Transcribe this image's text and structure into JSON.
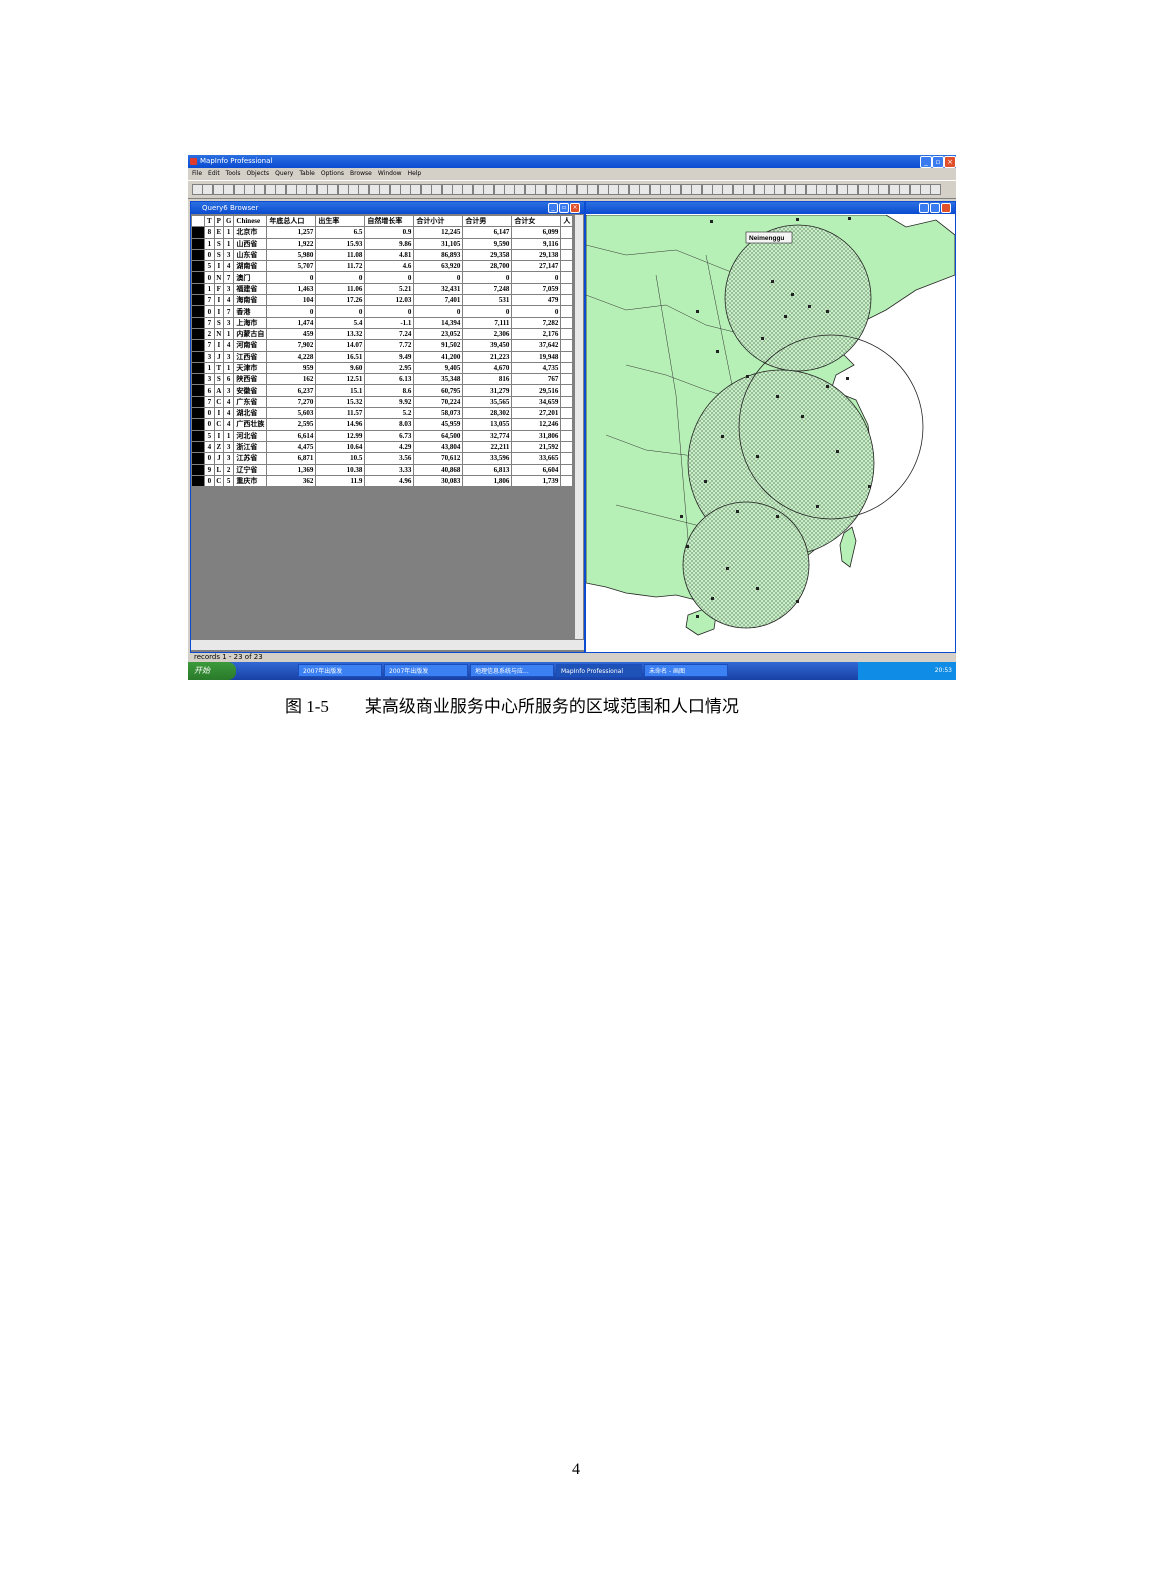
{
  "app": {
    "title": "MapInfo Professional",
    "menu": [
      "File",
      "Edit",
      "Tools",
      "Objects",
      "Query",
      "Table",
      "Options",
      "Browse",
      "Window",
      "Help"
    ]
  },
  "browser": {
    "title": "Query6 Browser",
    "columns": [
      "T",
      "P",
      "G",
      "Chinese",
      "年底总人口",
      "出生率",
      "自然增长率",
      "合计小计",
      "合计男",
      "合计女",
      "人"
    ],
    "rows": [
      [
        "8",
        "E",
        "1",
        "北京市",
        "1,257",
        "6.5",
        "0.9",
        "12,245",
        "6,147",
        "6,099"
      ],
      [
        "1",
        "S",
        "1",
        "山西省",
        "1,922",
        "15.93",
        "9.86",
        "31,105",
        "9,590",
        "9,116"
      ],
      [
        "0",
        "S",
        "3",
        "山东省",
        "5,980",
        "11.08",
        "4.81",
        "86,893",
        "29,358",
        "29,138"
      ],
      [
        "5",
        "I",
        "4",
        "湖南省",
        "5,707",
        "11.72",
        "4.6",
        "63,920",
        "28,700",
        "27,147"
      ],
      [
        "0",
        "N",
        "7",
        "澳门",
        "0",
        "0",
        "0",
        "0",
        "0",
        "0"
      ],
      [
        "1",
        "F",
        "3",
        "福建省",
        "1,463",
        "11.06",
        "5.21",
        "32,431",
        "7,248",
        "7,059"
      ],
      [
        "7",
        "I",
        "4",
        "海南省",
        "104",
        "17.26",
        "12.03",
        "7,401",
        "531",
        "479"
      ],
      [
        "0",
        "I",
        "7",
        "香港",
        "0",
        "0",
        "0",
        "0",
        "0",
        "0"
      ],
      [
        "7",
        "S",
        "3",
        "上海市",
        "1,474",
        "5.4",
        "-1.1",
        "14,394",
        "7,111",
        "7,282"
      ],
      [
        "2",
        "N",
        "1",
        "内蒙古自",
        "459",
        "13.32",
        "7.24",
        "23,052",
        "2,306",
        "2,176"
      ],
      [
        "7",
        "I",
        "4",
        "河南省",
        "7,902",
        "14.07",
        "7.72",
        "91,502",
        "39,450",
        "37,642"
      ],
      [
        "3",
        "J",
        "3",
        "江西省",
        "4,228",
        "16.51",
        "9.49",
        "41,200",
        "21,223",
        "19,948"
      ],
      [
        "1",
        "T",
        "1",
        "天津市",
        "959",
        "9.60",
        "2.95",
        "9,405",
        "4,670",
        "4,735"
      ],
      [
        "3",
        "S",
        "6",
        "陕西省",
        "162",
        "12.51",
        "6.13",
        "35,348",
        "816",
        "767"
      ],
      [
        "6",
        "A",
        "3",
        "安徽省",
        "6,237",
        "15.1",
        "8.6",
        "60,795",
        "31,279",
        "29,516"
      ],
      [
        "7",
        "C",
        "4",
        "广东省",
        "7,270",
        "15.32",
        "9.92",
        "70,224",
        "35,565",
        "34,659"
      ],
      [
        "0",
        "I",
        "4",
        "湖北省",
        "5,603",
        "11.57",
        "5.2",
        "58,073",
        "28,302",
        "27,201"
      ],
      [
        "0",
        "C",
        "4",
        "广西壮族",
        "2,595",
        "14.96",
        "8.03",
        "45,959",
        "13,055",
        "12,246"
      ],
      [
        "5",
        "I",
        "1",
        "河北省",
        "6,614",
        "12.99",
        "6.73",
        "64,500",
        "32,774",
        "31,806"
      ],
      [
        "4",
        "Z",
        "3",
        "浙江省",
        "4,475",
        "10.64",
        "4.29",
        "43,804",
        "22,211",
        "21,592"
      ],
      [
        "0",
        "J",
        "3",
        "江苏省",
        "6,871",
        "10.5",
        "3.56",
        "70,612",
        "33,596",
        "33,665"
      ],
      [
        "9",
        "L",
        "2",
        "辽宁省",
        "1,369",
        "10.38",
        "3.33",
        "40,868",
        "6,813",
        "6,604"
      ],
      [
        "0",
        "C",
        "5",
        "重庆市",
        "362",
        "11.9",
        "4.96",
        "30,083",
        "1,806",
        "1,739"
      ]
    ]
  },
  "map": {
    "label": "Neimenggu"
  },
  "statusbar": {
    "records": "records 1 - 23 of 23"
  },
  "taskbar": {
    "start": "开始",
    "tasks": [
      "2007年出版发",
      "2007年出版发",
      "地理信息系统与应...",
      "MapInfo Professional",
      "未命名 - 画图"
    ],
    "clock": "20:53"
  },
  "caption": {
    "figure": "图 1-5",
    "text": "某高级商业服务中心所服务的区域范围和人口情况"
  },
  "page_number": "4"
}
